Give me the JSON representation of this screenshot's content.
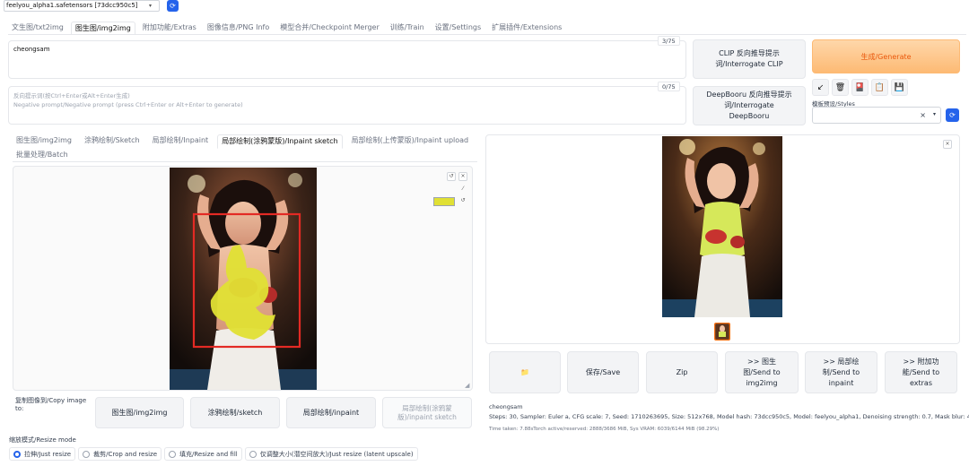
{
  "model": {
    "selected": "feelyou_alpha1.safetensors [73dcc950c5]"
  },
  "tabs": [
    {
      "label": "文生图/txt2img"
    },
    {
      "label": "图生图/img2img"
    },
    {
      "label": "附加功能/Extras"
    },
    {
      "label": "图像信息/PNG Info"
    },
    {
      "label": "模型合并/Checkpoint Merger"
    },
    {
      "label": "训练/Train"
    },
    {
      "label": "设置/Settings"
    },
    {
      "label": "扩展插件/Extensions"
    }
  ],
  "prompt": {
    "value": "cheongsam",
    "counter": "3/75"
  },
  "negative_prompt": {
    "placeholder_line1": "反向提示词(按Ctrl+Enter或Alt+Enter生成)",
    "placeholder_line2": "Negative prompt/Negative prompt (press Ctrl+Enter or Alt+Enter to generate)",
    "counter": "0/75"
  },
  "buttons": {
    "interrogate_clip": "CLIP 反向推导提示词/Interrogate CLIP",
    "interrogate_deepbooru": "DeepBooru 反向推导提示词/Interrogate DeepBooru",
    "generate": "生成/Generate"
  },
  "styles": {
    "label": "模板预设/Styles",
    "clear": "×"
  },
  "subtabs": [
    {
      "label": "图生图/img2img"
    },
    {
      "label": "涂鸦绘制/Sketch"
    },
    {
      "label": "局部绘制/Inpaint"
    },
    {
      "label": "局部绘制(涂鸦蒙版)/Inpaint sketch"
    },
    {
      "label": "局部绘制(上传蒙版)/Inpaint upload"
    },
    {
      "label": "批量处理/Batch"
    }
  ],
  "copy_image": {
    "label": "复制图像到/Copy image to:",
    "targets": [
      "图生图/img2img",
      "涂鸦绘制/sketch",
      "局部绘制/inpaint",
      "局部绘制(涂鸦蒙版)/inpaint sketch"
    ]
  },
  "resize": {
    "label": "缩放模式/Resize mode",
    "options": [
      "拉伸/Just resize",
      "裁剪/Crop and resize",
      "填充/Resize and fill",
      "仅调整大小(潜空间放大)/Just resize (latent upscale)"
    ],
    "selected": 0
  },
  "brush_color": "#e0e034",
  "output_actions": {
    "save": "保存/Save",
    "zip": "Zip",
    "send_img2img": ">> 图生图/Send to img2img",
    "send_inpaint": ">> 局部绘制/Send to inpaint",
    "send_extras": ">> 附加功能/Send to extras"
  },
  "generation_info": {
    "prompt": "cheongsam",
    "params": "Steps: 30, Sampler: Euler a, CFG scale: 7, Seed: 1710263695, Size: 512x768, Model hash: 73dcc950c5, Model: feelyou_alpha1, Denoising strength: 0.7, Mask blur: 4",
    "time": "Time taken: 7.88sTorch active/reserved: 2888/3686 MiB, Sys VRAM: 6039/6144 MiB (98.29%)"
  }
}
